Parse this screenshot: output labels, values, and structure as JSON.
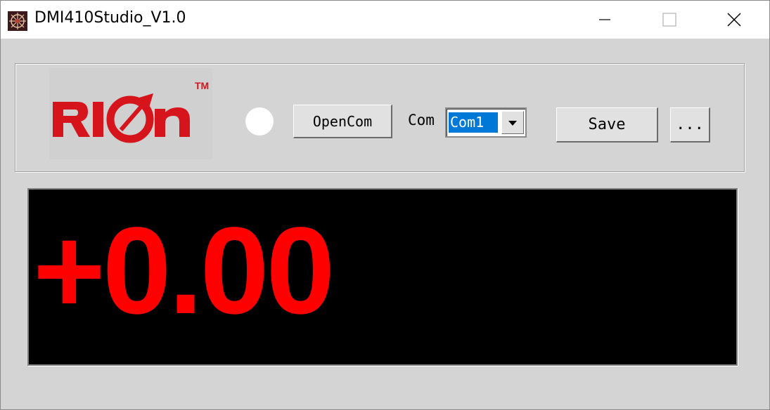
{
  "window": {
    "title": "DMI410Studio_V1.0",
    "icon": "app-icon"
  },
  "logo": {
    "text": "RION",
    "trademark": "TM",
    "color": "#d6141b"
  },
  "status_led": {
    "color": "#ffffff"
  },
  "toolbar": {
    "open_com_label": "OpenCom",
    "com_label": "Com",
    "com_selected": "Com1",
    "save_label": "Save",
    "more_label": "..."
  },
  "display": {
    "reading": "+0.00",
    "text_color": "#ff0000",
    "background": "#000000"
  }
}
